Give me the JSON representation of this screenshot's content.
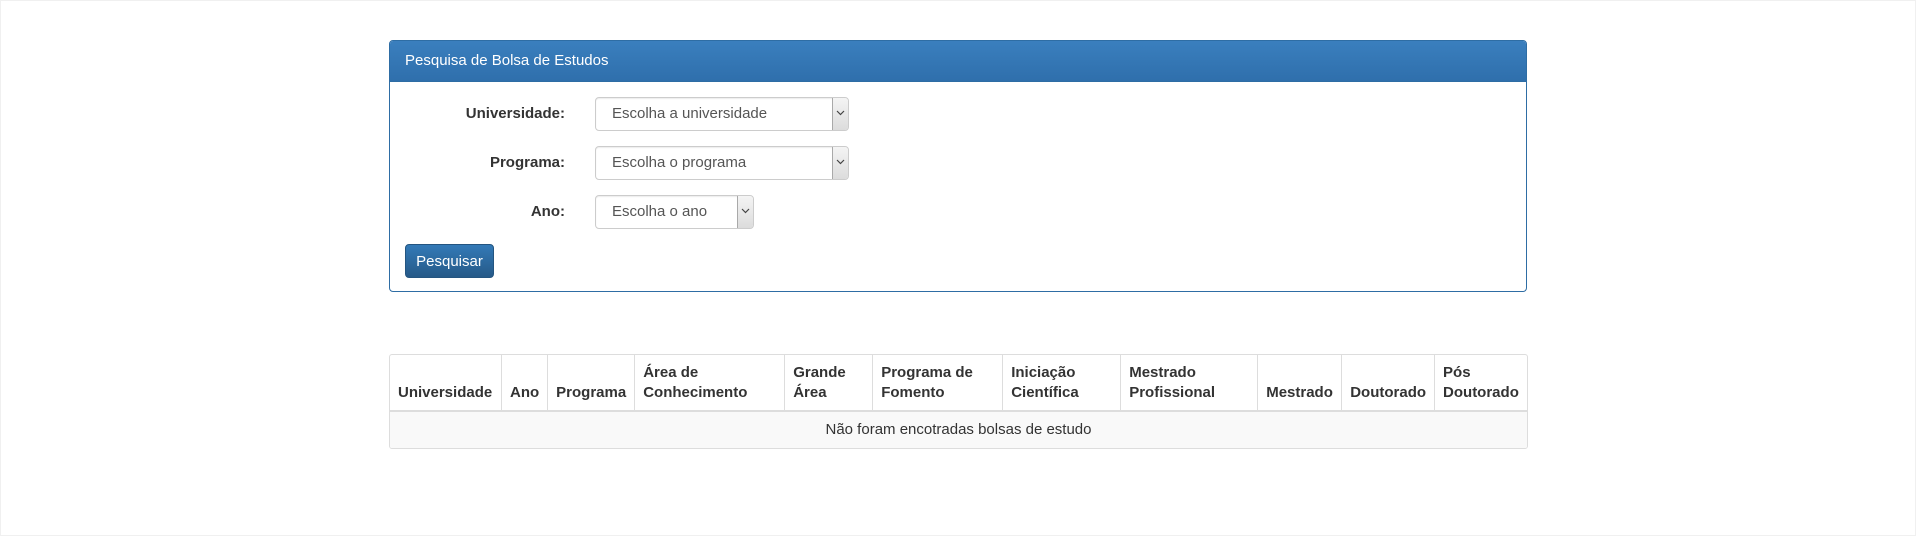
{
  "panel": {
    "title": "Pesquisa de Bolsa de Estudos"
  },
  "form": {
    "universidade_label": "Universidade:",
    "universidade_value": "Escolha a universidade",
    "programa_label": "Programa:",
    "programa_value": "Escolha o programa",
    "ano_label": "Ano:",
    "ano_value": "Escolha o ano",
    "submit_label": "Pesquisar"
  },
  "table": {
    "headers": [
      "Universidade",
      "Ano",
      "Programa",
      "Área de Conhecimento",
      "Grande Área",
      "Programa de Fomento",
      "Iniciação Científica",
      "Mestrado Profissional",
      "Mestrado",
      "Doutorado",
      "Pós Doutorado"
    ],
    "empty_message": "Não foram encotradas bolsas de estudo"
  },
  "colors": {
    "panel_header": "#337ab7",
    "button": "#286090",
    "border": "#dddddd",
    "empty_row_bg": "#f9f9f9"
  }
}
